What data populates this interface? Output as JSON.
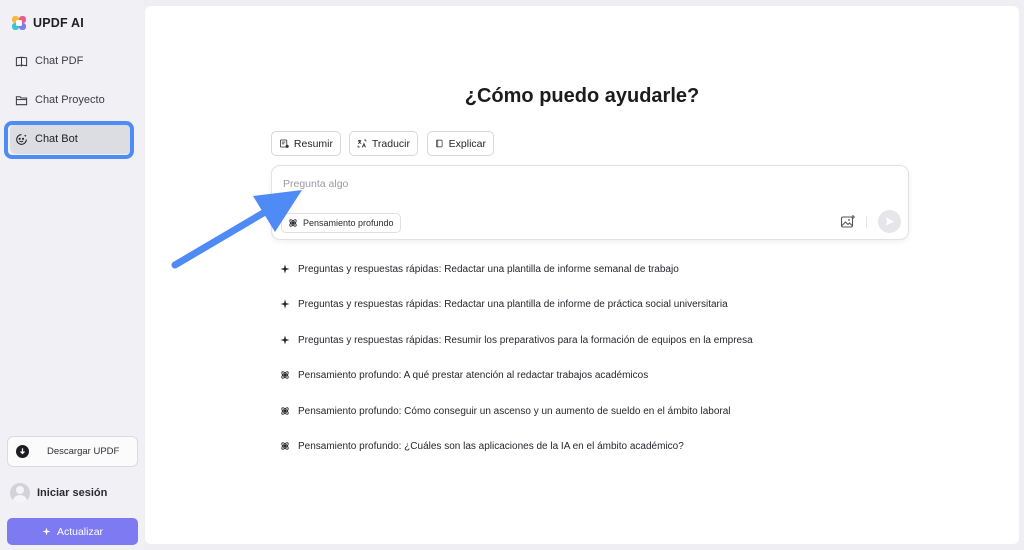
{
  "brand": {
    "name": "UPDF AI"
  },
  "sidebar": {
    "items": [
      {
        "label": "Chat PDF",
        "icon": "book-icon"
      },
      {
        "label": "Chat Proyecto",
        "icon": "folder-icon"
      },
      {
        "label": "Chat Bot",
        "icon": "bot-icon",
        "active": true
      }
    ],
    "download_label": "Descargar UPDF",
    "login_label": "Iniciar sesión",
    "upgrade_label": "Actualizar"
  },
  "main": {
    "heading": "¿Cómo puedo ayudarle?",
    "chips": [
      {
        "label": "Resumir",
        "icon": "summary-icon"
      },
      {
        "label": "Traducir",
        "icon": "translate-icon"
      },
      {
        "label": "Explicar",
        "icon": "book-open-icon"
      }
    ],
    "input": {
      "placeholder": "Pregunta algo",
      "value": "",
      "deep_think_label": "Pensamiento profundo"
    },
    "suggestions": [
      {
        "icon": "sparkle-icon",
        "text": "Preguntas y respuestas rápidas: Redactar una plantilla de informe semanal de trabajo"
      },
      {
        "icon": "sparkle-icon",
        "text": "Preguntas y respuestas rápidas: Redactar una plantilla de informe de práctica social universitaria"
      },
      {
        "icon": "sparkle-icon",
        "text": "Preguntas y respuestas rápidas: Resumir los preparativos para la formación de equipos en la empresa"
      },
      {
        "icon": "atom-icon",
        "text": "Pensamiento profundo: A qué prestar atención al redactar trabajos académicos"
      },
      {
        "icon": "atom-icon",
        "text": "Pensamiento profundo: Cómo conseguir un ascenso y un aumento de sueldo en el ámbito laboral"
      },
      {
        "icon": "atom-icon",
        "text": "Pensamiento profundo: ¿Cuáles son las aplicaciones de la IA en el ámbito académico?"
      }
    ]
  },
  "colors": {
    "accent": "#7e7af2",
    "highlight": "#4f8bf6",
    "sidebar_bg": "#f1f1f5"
  }
}
